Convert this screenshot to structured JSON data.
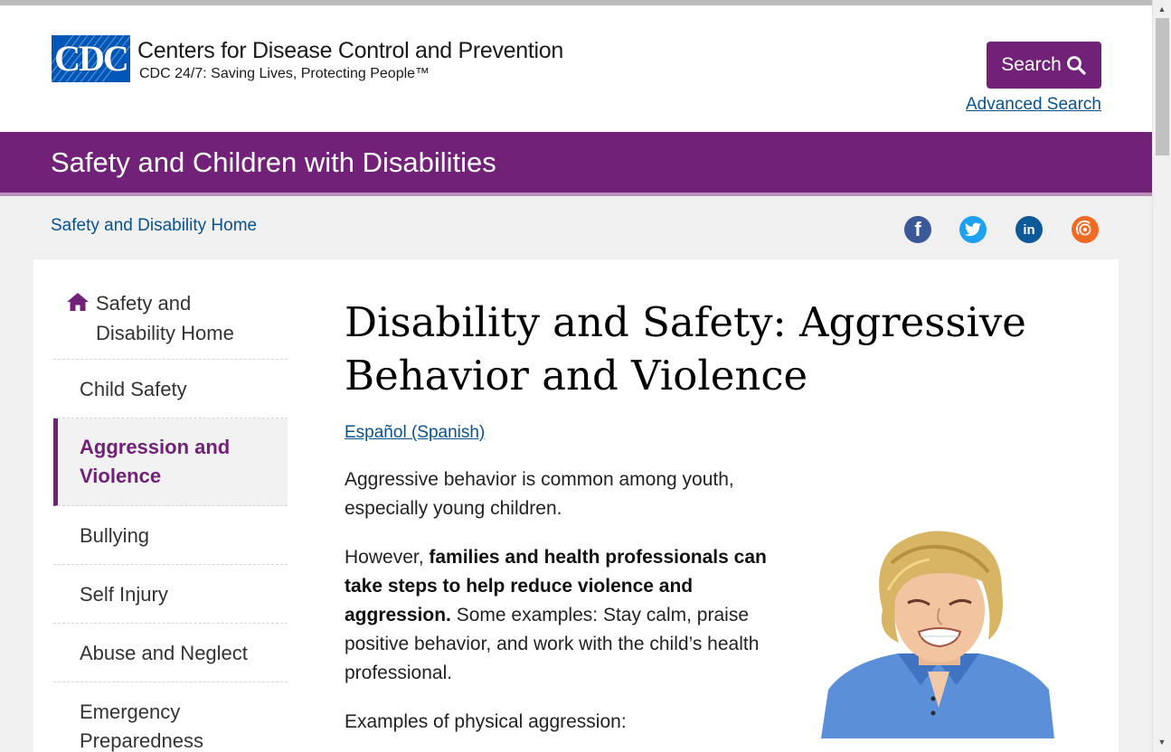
{
  "header": {
    "org_name": "Centers for Disease Control and Prevention",
    "tagline": "CDC 24/7: Saving Lives, Protecting People™",
    "logo_text": "CDC",
    "search_label": "Search",
    "advanced_search": "Advanced Search"
  },
  "site_title": "Safety and Children with Disabilities",
  "breadcrumb": "Safety and Disability Home",
  "social": {
    "facebook": "f",
    "twitter": "twitter-icon",
    "linkedin": "in",
    "syndicate": "syndicate-icon"
  },
  "sidebar": {
    "home": "Safety and Disability Home",
    "items": [
      {
        "label": "Child Safety"
      },
      {
        "label": "Aggression and Violence"
      },
      {
        "label": "Bullying"
      },
      {
        "label": "Self Injury"
      },
      {
        "label": "Abuse and Neglect"
      },
      {
        "label": "Emergency Preparedness"
      }
    ]
  },
  "article": {
    "title": "Disability and Safety: Aggressive Behavior and Violence",
    "language_link": "Español (Spanish)",
    "p1": "Aggressive behavior is common among youth, especially young children.",
    "p2_pre": "However, ",
    "p2_bold": "families and health professionals can take steps to help reduce violence and aggression.",
    "p2_post": " Some examples: Stay calm, praise positive behavior, and work with the child’s health professional.",
    "p3": "Examples of physical aggression:"
  },
  "colors": {
    "brand_purple": "#712177",
    "link_blue": "#075290",
    "cdc_blue": "#0057b7"
  }
}
